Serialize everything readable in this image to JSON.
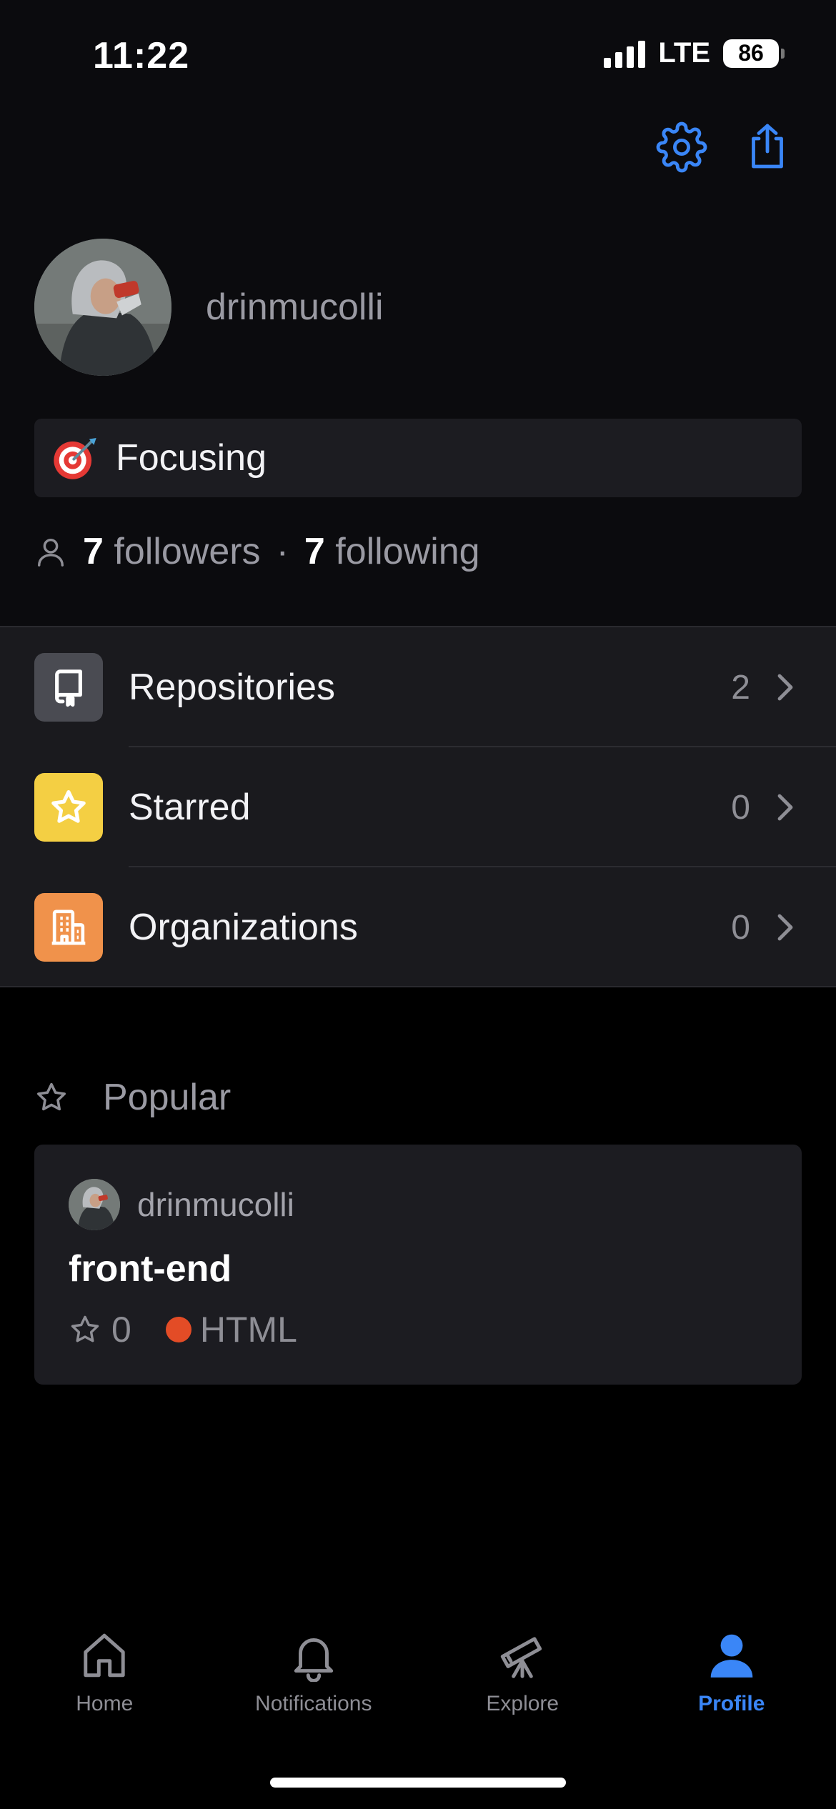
{
  "status_bar": {
    "time": "11:22",
    "network": "LTE",
    "battery": "86"
  },
  "header": {
    "settings_icon": "gear-icon",
    "share_icon": "share-icon"
  },
  "profile": {
    "username": "drinmucolli",
    "status_emoji": "dart-target-emoji",
    "status_text": "Focusing",
    "followers_count": "7",
    "followers_label": "followers",
    "separator": "·",
    "following_count": "7",
    "following_label": "following"
  },
  "menu": {
    "items": [
      {
        "label": "Repositories",
        "count": "2",
        "icon": "repo-icon",
        "color": "#4a4b52"
      },
      {
        "label": "Starred",
        "count": "0",
        "icon": "star-icon",
        "color": "#f4cf43"
      },
      {
        "label": "Organizations",
        "count": "0",
        "icon": "organization-icon",
        "color": "#f0924b"
      }
    ]
  },
  "popular": {
    "title": "Popular",
    "repo": {
      "owner": "drinmucolli",
      "name": "front-end",
      "stars": "0",
      "language": "HTML",
      "language_color": "#e34c26"
    }
  },
  "tabbar": {
    "tabs": [
      {
        "label": "Home",
        "icon": "home-icon",
        "active": false
      },
      {
        "label": "Notifications",
        "icon": "bell-icon",
        "active": false
      },
      {
        "label": "Explore",
        "icon": "telescope-icon",
        "active": false
      },
      {
        "label": "Profile",
        "icon": "person-icon",
        "active": true
      }
    ],
    "active_color": "#3a86f7",
    "inactive_color": "#8e8e95"
  }
}
